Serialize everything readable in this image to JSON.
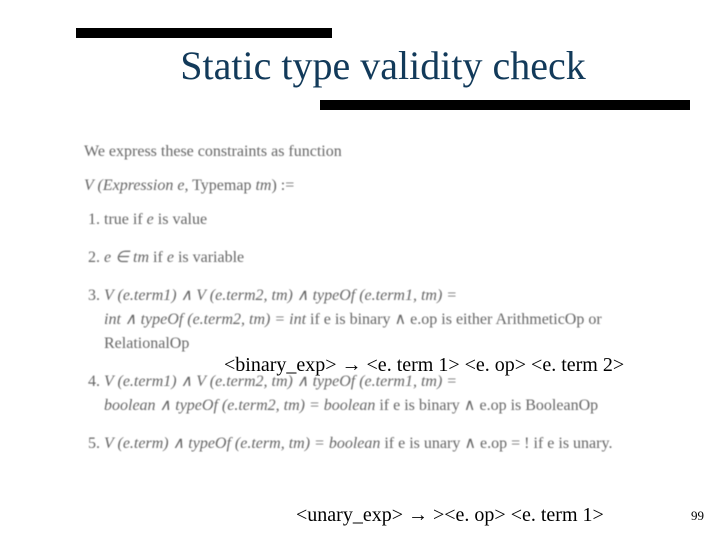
{
  "title": "Static type validity check",
  "intro": "We express these constraints as function",
  "vdecl_left": "V (Expression ",
  "vdecl_e": "e",
  "vdecl_mid": ", Typemap ",
  "vdecl_tm": "tm",
  "vdecl_right": ") :=",
  "items": [
    {
      "a": "true if ",
      "e": "e",
      "b": " is value"
    },
    {
      "a": "",
      "e": "e ∈ tm",
      "b": " if ",
      "e2": "e",
      "c": " is variable"
    },
    {
      "a": "",
      "e": "V (e.term1) ∧ V (e.term2, tm) ∧ typeOf (e.term1, tm) =",
      "line2a": "int ∧ typeOf (e.term2, tm) = int",
      "line2b": "  if e is binary ∧ e.op is either ArithmeticOp or",
      "line3": "RelationalOp"
    },
    {
      "a": "",
      "e": "V (e.term1) ∧ V (e.term2, tm) ∧ typeOf (e.term1, tm) =",
      "line2a": "boolean ∧ typeOf (e.term2, tm) = boolean",
      "line2b": "  if e is binary ∧ e.op is BooleanOp"
    },
    {
      "a": "",
      "e": "V (e.term) ∧ typeOf (e.term, tm) = boolean",
      "b": " if e is unary ∧ e.op = ! if e is unary."
    }
  ],
  "annot1_parts": {
    "a": "<binary_exp> ",
    "arrow": "→",
    "b": " <e. term 1> <e. op> <e. term 2>"
  },
  "annot2_parts": {
    "a": "<unary_exp> ",
    "arrow": "→",
    "b": " ><e. op> <e. term 1>"
  },
  "pagenum": "99"
}
